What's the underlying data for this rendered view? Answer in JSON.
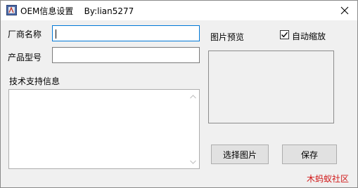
{
  "window": {
    "title": "OEM信息设置    By:lian5277"
  },
  "form": {
    "vendor_label": "厂商名称",
    "vendor_value": "",
    "model_label": "产品型号",
    "model_value": "",
    "support_label": "技术支持信息",
    "support_value": ""
  },
  "preview": {
    "label": "图片预览",
    "auto_scale_label": "自动缩放",
    "auto_scale_checked": true
  },
  "buttons": {
    "select_image": "选择图片",
    "save": "保存"
  },
  "watermark": "木蚂蚁社区",
  "colors": {
    "focus_border": "#0078d7",
    "watermark": "#d11a1a"
  }
}
